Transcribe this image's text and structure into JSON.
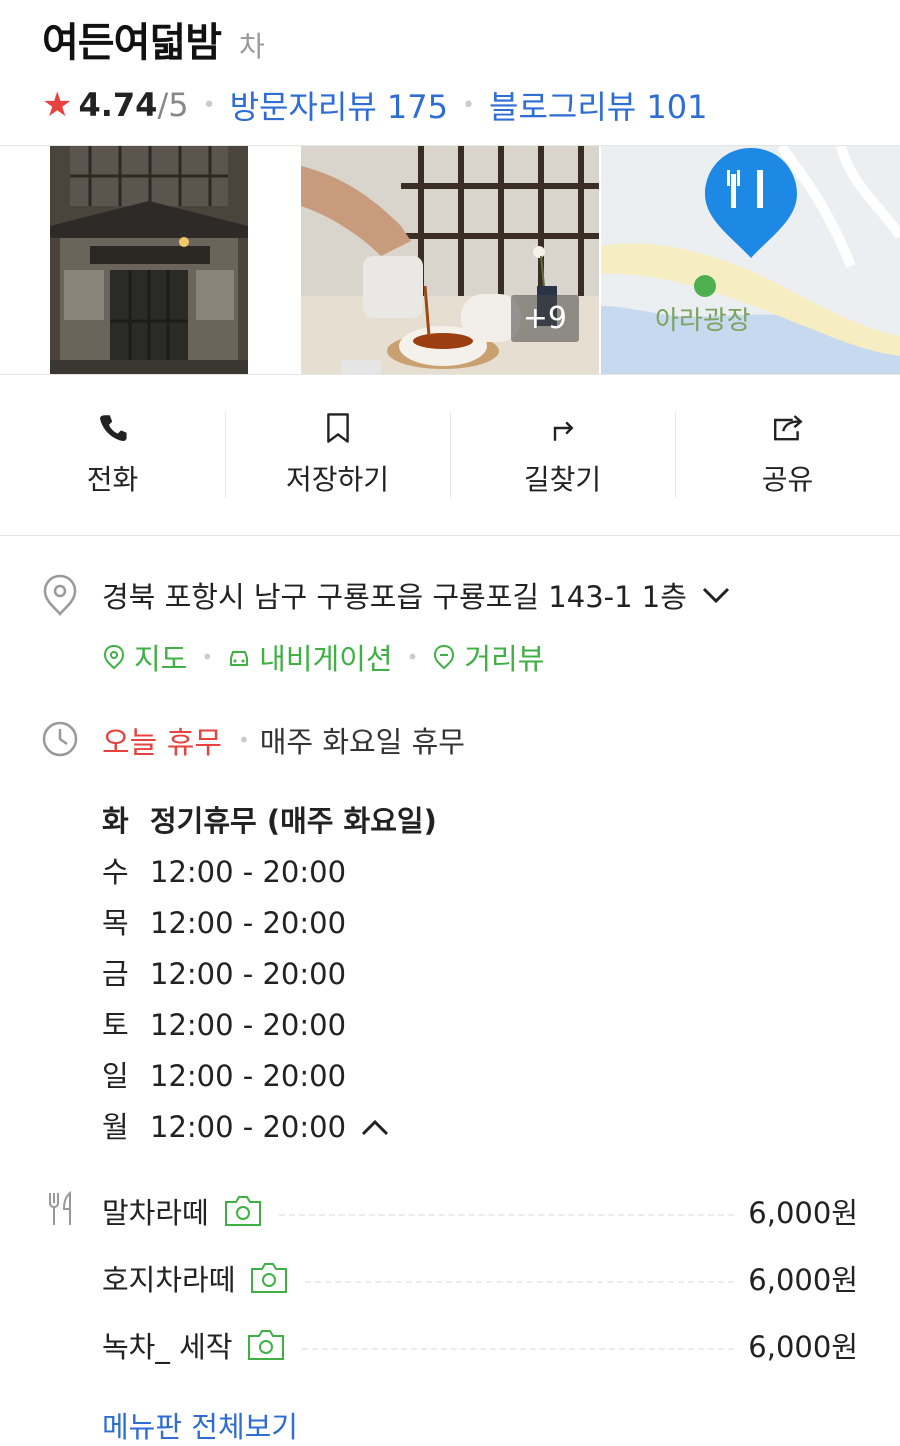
{
  "place": {
    "name": "여든여덟밤",
    "category": "차"
  },
  "rating": {
    "score": "4.74",
    "max": "/5",
    "visitor_reviews": "방문자리뷰 175",
    "blog_reviews": "블로그리뷰 101"
  },
  "photos": {
    "more_count": "+9",
    "map_place_label": "아라광장"
  },
  "actions": [
    {
      "label": "전화",
      "icon": "phone-icon"
    },
    {
      "label": "저장하기",
      "icon": "bookmark-icon"
    },
    {
      "label": "길찾기",
      "icon": "directions-icon"
    },
    {
      "label": "공유",
      "icon": "share-icon"
    }
  ],
  "address": {
    "text": "경북 포항시 남구 구룡포읍 구룡포길 143-1 1층",
    "links": {
      "map": "지도",
      "navigation": "내비게이션",
      "streetview": "거리뷰"
    }
  },
  "hours": {
    "status": "오늘 휴무",
    "note": "매주 화요일 휴무",
    "schedule": [
      {
        "day": "화",
        "time": "정기휴무 (매주 화요일)"
      },
      {
        "day": "수",
        "time": "12:00 - 20:00"
      },
      {
        "day": "목",
        "time": "12:00 - 20:00"
      },
      {
        "day": "금",
        "time": "12:00 - 20:00"
      },
      {
        "day": "토",
        "time": "12:00 - 20:00"
      },
      {
        "day": "일",
        "time": "12:00 - 20:00"
      },
      {
        "day": "월",
        "time": "12:00 - 20:00"
      }
    ]
  },
  "menu": {
    "items": [
      {
        "name": "말차라떼",
        "price": "6,000원"
      },
      {
        "name": "호지차라떼",
        "price": "6,000원"
      },
      {
        "name": "녹차_ 세작",
        "price": "6,000원"
      }
    ],
    "view_all": "메뉴판 전체보기"
  },
  "colors": {
    "accent_blue": "#2e6dd3",
    "accent_green": "#3fb144",
    "accent_red": "#e8423f",
    "pin_blue": "#1e88e5"
  }
}
